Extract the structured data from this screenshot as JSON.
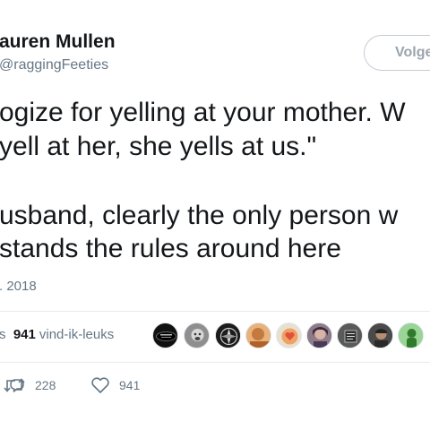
{
  "tweet": {
    "display_name": "auren Mullen",
    "handle": "raggingFeeties",
    "follow_label": "Volge",
    "text_lines": [
      "ogize for yelling at your mother. W",
      "yell at her, she yells at us.\"",
      "usband, clearly the only person w",
      "stands the rules around here"
    ],
    "date": ". 2018"
  },
  "stats": {
    "likes_prefix": "s",
    "likes_count": "941",
    "likes_label": "vind-ik-leuks"
  },
  "avatars": [
    "black-badge",
    "grey-face",
    "dark-emblem",
    "orange-portrait",
    "heart-sign",
    "woman-portrait",
    "sign-badge",
    "man-portrait",
    "green-figure"
  ],
  "actions": {
    "retweets": "228",
    "likes": "941"
  },
  "colors": {
    "text": "#14171a",
    "muted": "#657786",
    "border": "#e6ecf0"
  }
}
